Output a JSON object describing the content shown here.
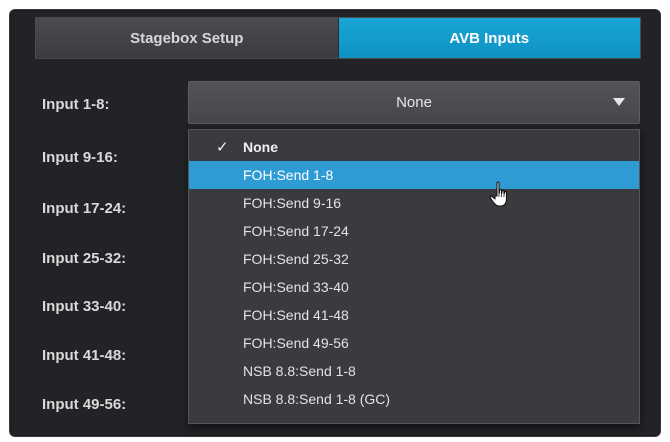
{
  "tabs": [
    {
      "label": "Stagebox Setup",
      "active": false
    },
    {
      "label": "AVB Inputs",
      "active": true
    }
  ],
  "input_labels": [
    "Input 1-8:",
    "Input 9-16:",
    "Input 17-24:",
    "Input 25-32:",
    "Input 33-40:",
    "Input 41-48:",
    "Input 49-56:"
  ],
  "dropdown": {
    "selected_value": "None",
    "arrow_icon": "triangle-down-icon"
  },
  "menu": {
    "checked_index": 0,
    "hovered_index": 1,
    "items": [
      "None",
      "FOH:Send 1-8",
      "FOH:Send 9-16",
      "FOH:Send 17-24",
      "FOH:Send 25-32",
      "FOH:Send 33-40",
      "FOH:Send 41-48",
      "FOH:Send 49-56",
      "NSB 8.8:Send 1-8",
      "NSB 8.8:Send 1-8 (GC)"
    ]
  },
  "colors": {
    "accent": "#18a6d6",
    "hover": "#2f9bd4",
    "panel": "#222326"
  }
}
